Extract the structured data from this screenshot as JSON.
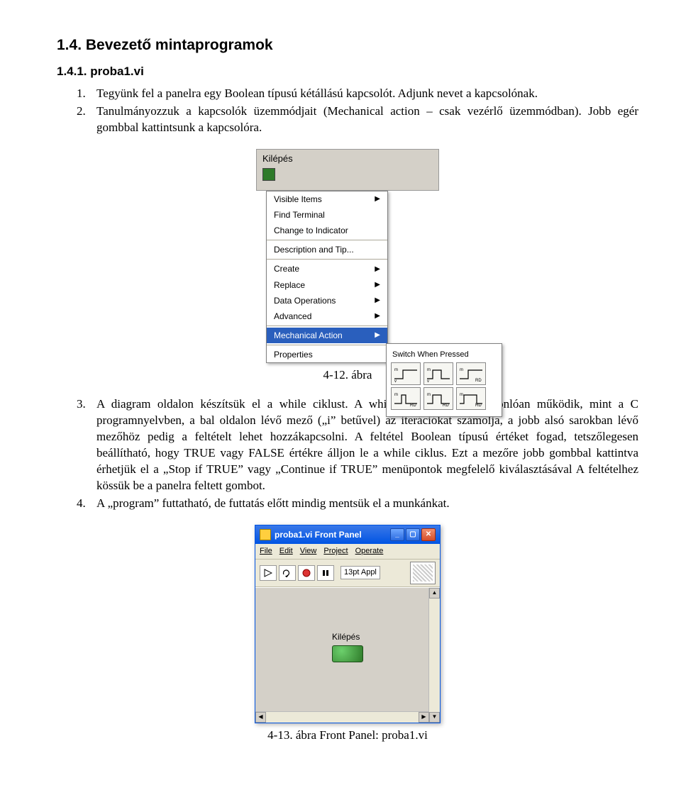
{
  "heading1": "1.4. Bevezető mintaprogramok",
  "heading2": "1.4.1. proba1.vi",
  "items1": [
    {
      "num": "1.",
      "text": "Tegyünk fel a panelra egy Boolean típusú kétállású kapcsolót. Adjunk nevet a kapcsolónak."
    },
    {
      "num": "2.",
      "text": "Tanulmányozzuk a kapcsolók üzemmódjait (Mechanical action – csak vezérlő üzemmódban). Jobb egér gombbal kattintsunk a kapcsolóra."
    }
  ],
  "figure1": {
    "panel_label": "Kilépés",
    "menu": {
      "items_a": [
        {
          "label": "Visible Items",
          "arrow": true
        },
        {
          "label": "Find Terminal",
          "arrow": false
        },
        {
          "label": "Change to Indicator",
          "arrow": false
        }
      ],
      "items_b": [
        {
          "label": "Description and Tip...",
          "arrow": false
        }
      ],
      "items_c": [
        {
          "label": "Create",
          "arrow": true
        },
        {
          "label": "Replace",
          "arrow": true
        },
        {
          "label": "Data Operations",
          "arrow": true
        },
        {
          "label": "Advanced",
          "arrow": true
        }
      ],
      "items_d_hl": {
        "label": "Mechanical Action",
        "arrow": true
      },
      "items_e": [
        {
          "label": "Properties",
          "arrow": false
        }
      ]
    },
    "submenu_title": "Switch When Pressed",
    "caption": "4-12. ábra"
  },
  "items2": [
    {
      "num": "3.",
      "text": "A diagram oldalon készítsük el a while ciklust.  A while ciklus teljesen hasonlóan működik, mint a C programnyelvben, a bal oldalon lévő mező („i” betűvel) az iterációkat számolja, a jobb alsó sarokban lévő mezőhöz pedig a feltételt lehet hozzákapcsolni. A feltétel Boolean típusú értéket fogad, tetszőlegesen beállítható, hogy TRUE vagy FALSE értékre álljon le a while ciklus. Ezt a mezőre jobb gombbal kattintva érhetjük el a „Stop if TRUE” vagy „Continue if TRUE” menüpontok megfelelő kiválasztásával A feltételhez kössük be a panelra feltett gombot."
    },
    {
      "num": "4.",
      "text": "A „program” futtatható, de futtatás előtt mindig mentsük el a munkánkat."
    }
  ],
  "figure2": {
    "title": "proba1.vi Front Panel",
    "menus": [
      "File",
      "Edit",
      "View",
      "Project",
      "Operate"
    ],
    "font_label": "13pt Appl",
    "button_label": "Kilépés",
    "caption": "4-13. ábra Front Panel: proba1.vi"
  }
}
